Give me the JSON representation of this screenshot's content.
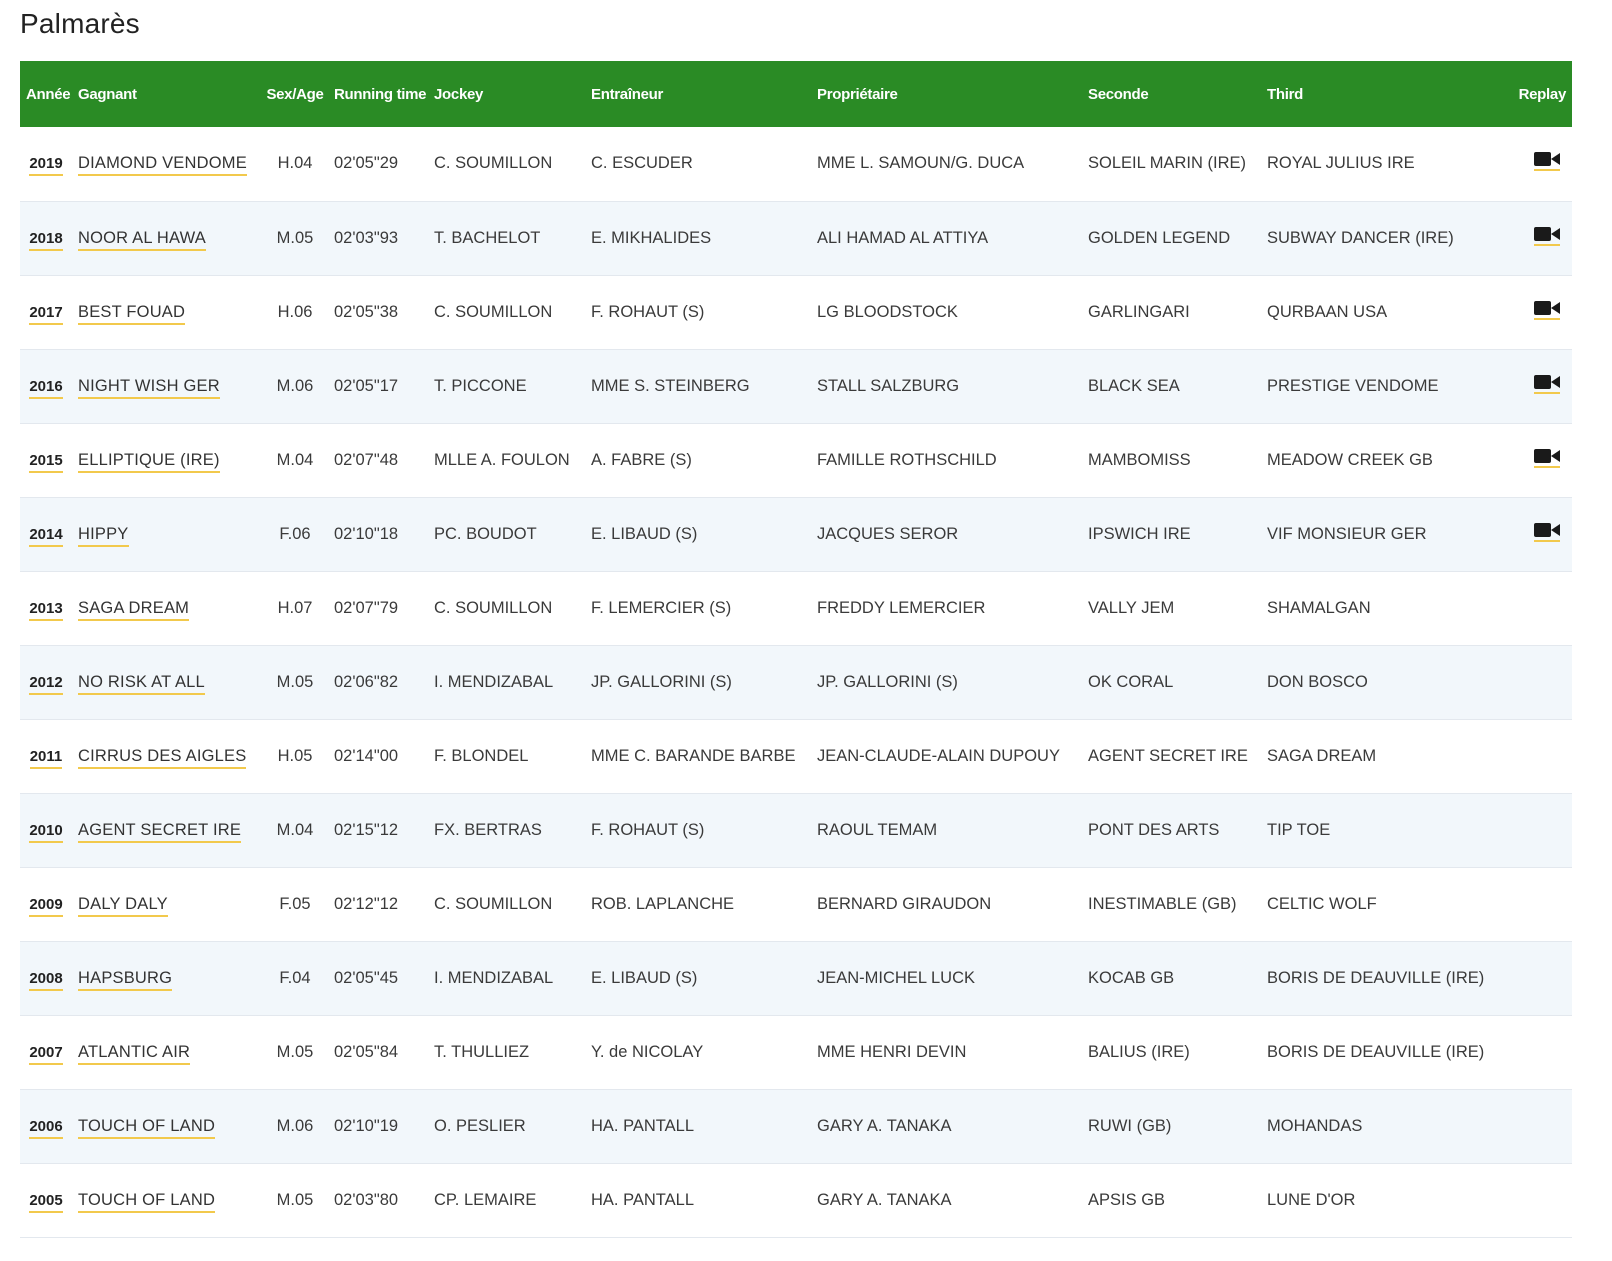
{
  "page_title": "Palmarès",
  "colors": {
    "header_bg": "#2a8b25",
    "accent_underline": "#f2c94c",
    "row_alt": "#f2f7fb"
  },
  "columns": {
    "year": "Année",
    "winner": "Gagnant",
    "sex_age": "Sex/Age",
    "running_time": "Running time",
    "jockey": "Jockey",
    "trainer": "Entraîneur",
    "owner": "Propriétaire",
    "second": "Seconde",
    "third": "Third",
    "replay": "Replay"
  },
  "rows": [
    {
      "year": "2019",
      "winner": "DIAMOND VENDOME",
      "sex_age": "H.04",
      "time": "02'05\"29",
      "jockey": "C. SOUMILLON",
      "trainer": "C. ESCUDER",
      "owner": "MME L. SAMOUN/G. DUCA",
      "second": "SOLEIL MARIN (IRE)",
      "third": "ROYAL JULIUS IRE",
      "replay": true,
      "replay_icon": "video-camera-icon"
    },
    {
      "year": "2018",
      "winner": "NOOR AL HAWA",
      "sex_age": "M.05",
      "time": "02'03\"93",
      "jockey": "T. BACHELOT",
      "trainer": "E. MIKHALIDES",
      "owner": "ALI HAMAD AL ATTIYA",
      "second": "GOLDEN LEGEND",
      "third": "SUBWAY DANCER (IRE)",
      "replay": true,
      "replay_icon": "video-camera-icon"
    },
    {
      "year": "2017",
      "winner": "BEST FOUAD",
      "sex_age": "H.06",
      "time": "02'05\"38",
      "jockey": "C. SOUMILLON",
      "trainer": "F. ROHAUT (S)",
      "owner": "LG BLOODSTOCK",
      "second": "GARLINGARI",
      "third": "QURBAAN USA",
      "replay": true,
      "replay_icon": "video-camera-icon"
    },
    {
      "year": "2016",
      "winner": "NIGHT WISH GER",
      "sex_age": "M.06",
      "time": "02'05\"17",
      "jockey": "T. PICCONE",
      "trainer": "MME S. STEINBERG",
      "owner": "STALL SALZBURG",
      "second": "BLACK SEA",
      "third": "PRESTIGE VENDOME",
      "replay": true,
      "replay_icon": "video-camera-icon"
    },
    {
      "year": "2015",
      "winner": "ELLIPTIQUE (IRE)",
      "sex_age": "M.04",
      "time": "02'07\"48",
      "jockey": "MLLE A. FOULON",
      "trainer": "A. FABRE (S)",
      "owner": "FAMILLE ROTHSCHILD",
      "second": "MAMBOMISS",
      "third": "MEADOW CREEK GB",
      "replay": true,
      "replay_icon": "video-camera-icon"
    },
    {
      "year": "2014",
      "winner": "HIPPY",
      "sex_age": "F.06",
      "time": "02'10\"18",
      "jockey": "PC. BOUDOT",
      "trainer": "E. LIBAUD (S)",
      "owner": "JACQUES SEROR",
      "second": "IPSWICH IRE",
      "third": "VIF MONSIEUR GER",
      "replay": true,
      "replay_icon": "video-camera-icon"
    },
    {
      "year": "2013",
      "winner": "SAGA DREAM",
      "sex_age": "H.07",
      "time": "02'07\"79",
      "jockey": "C. SOUMILLON",
      "trainer": "F. LEMERCIER (S)",
      "owner": "FREDDY LEMERCIER",
      "second": "VALLY JEM",
      "third": "SHAMALGAN",
      "replay": false
    },
    {
      "year": "2012",
      "winner": "NO RISK AT ALL",
      "sex_age": "M.05",
      "time": "02'06\"82",
      "jockey": "I. MENDIZABAL",
      "trainer": "JP. GALLORINI (S)",
      "owner": "JP. GALLORINI (S)",
      "second": "OK CORAL",
      "third": "DON BOSCO",
      "replay": false
    },
    {
      "year": "2011",
      "winner": "CIRRUS DES AIGLES",
      "sex_age": "H.05",
      "time": "02'14\"00",
      "jockey": "F. BLONDEL",
      "trainer": "MME C. BARANDE BARBE",
      "owner": "JEAN-CLAUDE-ALAIN DUPOUY",
      "second": "AGENT SECRET IRE",
      "third": "SAGA DREAM",
      "replay": false
    },
    {
      "year": "2010",
      "winner": "AGENT SECRET IRE",
      "sex_age": "M.04",
      "time": "02'15\"12",
      "jockey": "FX. BERTRAS",
      "trainer": "F. ROHAUT (S)",
      "owner": "RAOUL TEMAM",
      "second": "PONT DES ARTS",
      "third": "TIP TOE",
      "replay": false
    },
    {
      "year": "2009",
      "winner": "DALY DALY",
      "sex_age": "F.05",
      "time": "02'12\"12",
      "jockey": "C. SOUMILLON",
      "trainer": "ROB. LAPLANCHE",
      "owner": "BERNARD GIRAUDON",
      "second": "INESTIMABLE (GB)",
      "third": "CELTIC WOLF",
      "replay": false
    },
    {
      "year": "2008",
      "winner": "HAPSBURG",
      "sex_age": "F.04",
      "time": "02'05\"45",
      "jockey": "I. MENDIZABAL",
      "trainer": "E. LIBAUD (S)",
      "owner": "JEAN-MICHEL LUCK",
      "second": "KOCAB GB",
      "third": "BORIS DE DEAUVILLE (IRE)",
      "replay": false
    },
    {
      "year": "2007",
      "winner": "ATLANTIC AIR",
      "sex_age": "M.05",
      "time": "02'05\"84",
      "jockey": "T. THULLIEZ",
      "trainer": "Y. de NICOLAY",
      "owner": "MME HENRI DEVIN",
      "second": "BALIUS (IRE)",
      "third": "BORIS DE DEAUVILLE (IRE)",
      "replay": false
    },
    {
      "year": "2006",
      "winner": "TOUCH OF LAND",
      "sex_age": "M.06",
      "time": "02'10\"19",
      "jockey": "O. PESLIER",
      "trainer": "HA. PANTALL",
      "owner": "GARY A. TANAKA",
      "second": "RUWI (GB)",
      "third": "MOHANDAS",
      "replay": false
    },
    {
      "year": "2005",
      "winner": "TOUCH OF LAND",
      "sex_age": "M.05",
      "time": "02'03\"80",
      "jockey": "CP. LEMAIRE",
      "trainer": "HA. PANTALL",
      "owner": "GARY A. TANAKA",
      "second": "APSIS GB",
      "third": "LUNE D'OR",
      "replay": false
    }
  ]
}
